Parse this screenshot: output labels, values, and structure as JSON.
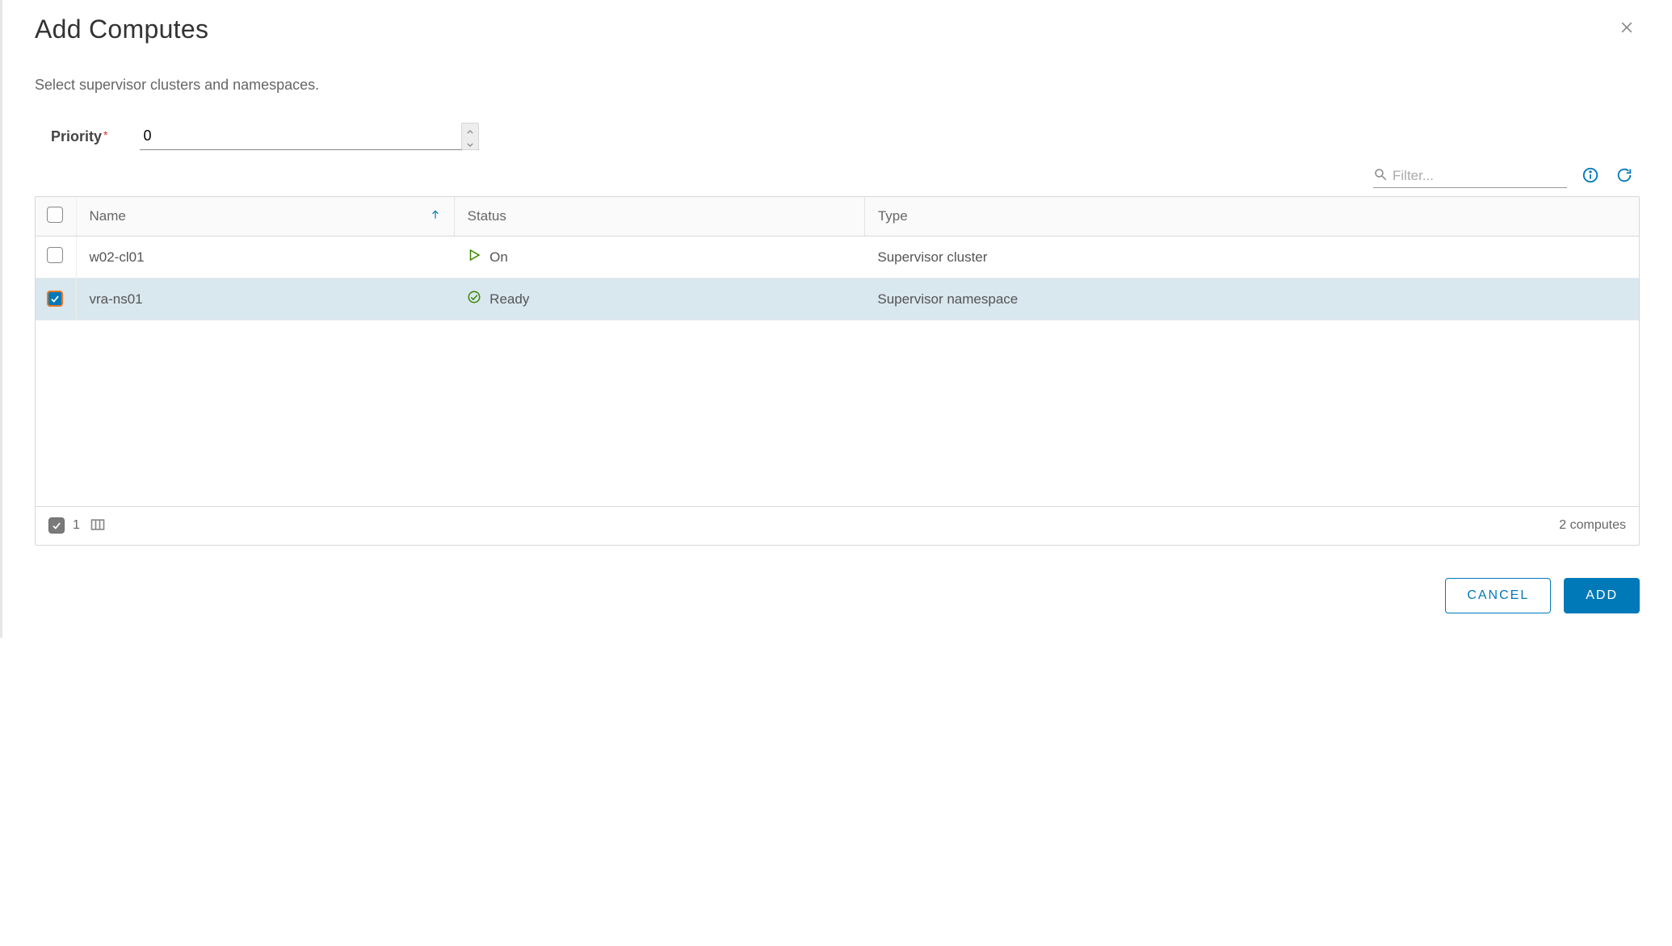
{
  "dialog": {
    "title": "Add Computes",
    "subtitle": "Select supervisor clusters and namespaces."
  },
  "form": {
    "priority_label": "Priority",
    "priority_value": "0"
  },
  "search": {
    "placeholder": "Filter..."
  },
  "table": {
    "headers": {
      "name": "Name",
      "status": "Status",
      "type": "Type"
    },
    "rows": [
      {
        "selected": false,
        "name": "w02-cl01",
        "status_icon": "play",
        "status_text": "On",
        "type": "Supervisor cluster"
      },
      {
        "selected": true,
        "name": "vra-ns01",
        "status_icon": "check-circle",
        "status_text": "Ready",
        "type": "Supervisor namespace"
      }
    ],
    "footer": {
      "selected_count": "1",
      "total_text": "2 computes"
    }
  },
  "buttons": {
    "cancel": "CANCEL",
    "add": "ADD"
  }
}
